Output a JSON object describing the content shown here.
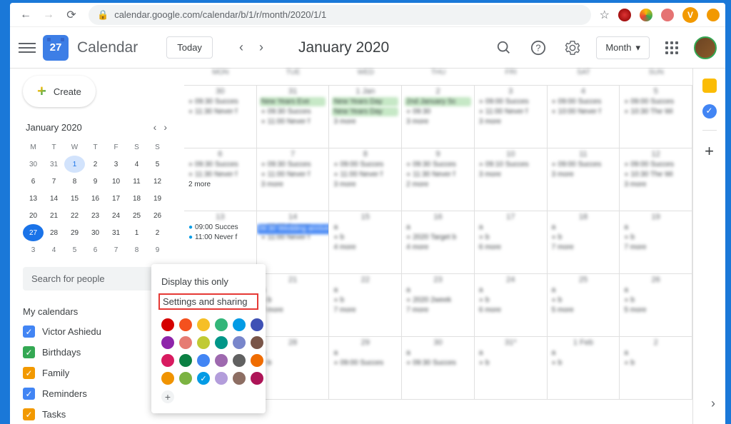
{
  "browser": {
    "url": "calendar.google.com/calendar/b/1/r/month/2020/1/1",
    "user_letter": "V"
  },
  "header": {
    "logo_day": "27",
    "app_name": "Calendar",
    "today_btn": "Today",
    "month_title": "January 2020",
    "view_label": "Month"
  },
  "sidebar": {
    "create_label": "Create",
    "mini_title": "January 2020",
    "search_placeholder": "Search for people",
    "mycalendars_label": "My calendars",
    "calendars": [
      {
        "label": "Victor Ashiedu",
        "color": "#4285f4"
      },
      {
        "label": "Birthdays",
        "color": "#34a853"
      },
      {
        "label": "Family",
        "color": "#f29900"
      },
      {
        "label": "Reminders",
        "color": "#4285f4"
      },
      {
        "label": "Tasks",
        "color": "#f29900"
      }
    ],
    "mini_days": [
      "M",
      "T",
      "W",
      "T",
      "F",
      "S",
      "S"
    ],
    "mini_weeks": [
      [
        "30",
        "31",
        "1",
        "2",
        "3",
        "4",
        "5"
      ],
      [
        "6",
        "7",
        "8",
        "9",
        "10",
        "11",
        "12"
      ],
      [
        "13",
        "14",
        "15",
        "16",
        "17",
        "18",
        "19"
      ],
      [
        "20",
        "21",
        "22",
        "23",
        "24",
        "25",
        "26"
      ],
      [
        "27",
        "28",
        "29",
        "30",
        "31",
        "1",
        "2"
      ],
      [
        "3",
        "4",
        "5",
        "6",
        "7",
        "8",
        "9"
      ]
    ],
    "today_idx": "1",
    "selected_idx": "27"
  },
  "popup": {
    "display_only": "Display this only",
    "settings_sharing": "Settings and sharing",
    "colors": [
      "#d50000",
      "#f4511e",
      "#f6bf26",
      "#33b679",
      "#039be5",
      "#3f51b5",
      "#8e24aa",
      "#e67c73",
      "#c0ca33",
      "#009688",
      "#7986cb",
      "#795548",
      "#d81b60",
      "#0b8043",
      "#4285f4",
      "#9e69af",
      "#616161",
      "#ef6c00",
      "#f09300",
      "#7cb342",
      "#039be5",
      "#b39ddb",
      "#8d6e63",
      "#ad1457"
    ],
    "selected_color_idx": 20
  },
  "grid": {
    "day_headers": [
      "MON",
      "TUE",
      "WED",
      "THU",
      "FRI",
      "SAT",
      "SUN"
    ],
    "week1_clear_more": "2 more",
    "events_clear": {
      "mon13_a": "09:00 Succes",
      "mon13_b": "11:00 Never f"
    }
  }
}
